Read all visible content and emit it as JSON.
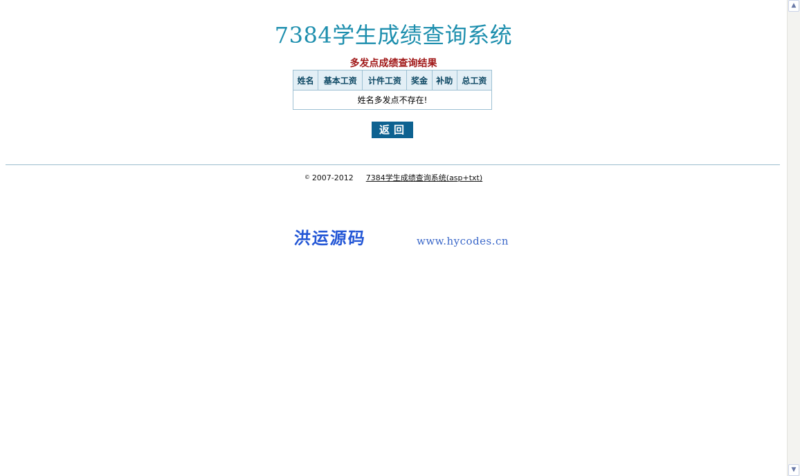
{
  "header": {
    "title": "7384学生成绩查询系统"
  },
  "result": {
    "title": "多发点成绩查询结果",
    "columns": [
      "姓名",
      "基本工资",
      "计件工资",
      "奖金",
      "补助",
      "总工资"
    ],
    "message": "姓名多发点不存在!"
  },
  "actions": {
    "back_label": "返回"
  },
  "footer": {
    "copyright_symbol": "©",
    "years": "2007-2012",
    "link_text": "7384学生成绩查询系统(asp+txt)"
  },
  "brand": {
    "logo_text": "洪运源码",
    "url": "www.hycodes.cn"
  },
  "scrollbar": {
    "up_icon": "▲",
    "down_icon": "▼"
  },
  "colors": {
    "title": "#1e8fae",
    "result_title": "#a01818",
    "button_bg": "#0e6291",
    "brand": "#2457d6"
  }
}
